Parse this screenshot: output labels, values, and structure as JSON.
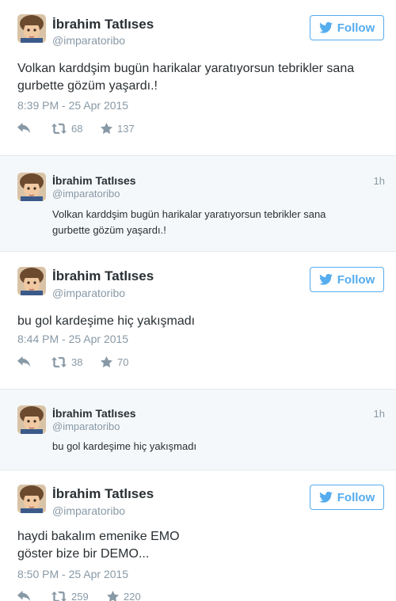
{
  "colors": {
    "accent": "#55acee",
    "text": "#292f33",
    "muted": "#8899a6",
    "embed_bg": "#f5f8fa",
    "separator": "#e1e8ed"
  },
  "tweets": [
    {
      "name": "İbrahim Tatlıses",
      "handle": "@imparatoribo",
      "follow_label": "Follow",
      "text_lines": [
        "Volkan karddşim bugün harikalar yaratıyorsun tebrikler sana",
        "gurbette gözüm yaşardı.!"
      ],
      "timestamp": "8:39 PM - 25 Apr 2015",
      "retweets": "68",
      "favorites": "137"
    },
    {
      "name": "İbrahim Tatlıses",
      "handle": "@imparatoribo",
      "follow_label": "Follow",
      "text_lines": [
        "bu gol kardeşime hiç yakışmadı"
      ],
      "timestamp": "8:44 PM - 25 Apr 2015",
      "retweets": "38",
      "favorites": "70"
    },
    {
      "name": "İbrahim Tatlıses",
      "handle": "@imparatoribo",
      "follow_label": "Follow",
      "text_lines": [
        "haydi bakalım emenike EMO",
        "göster bize bir DEMO..."
      ],
      "timestamp": "8:50 PM - 25 Apr 2015",
      "retweets": "259",
      "favorites": "220"
    }
  ],
  "compact_tweets": [
    {
      "name": "İbrahim Tatlıses",
      "handle": "@imparatoribo",
      "age": "1h",
      "text_lines": [
        "Volkan karddşim bugün harikalar yaratıyorsun tebrikler sana",
        "gurbette gözüm yaşardı.!"
      ]
    },
    {
      "name": "İbrahim Tatlıses",
      "handle": "@imparatoribo",
      "age": "1h",
      "text_lines": [
        "bu gol kardeşime hiç yakışmadı"
      ]
    }
  ]
}
